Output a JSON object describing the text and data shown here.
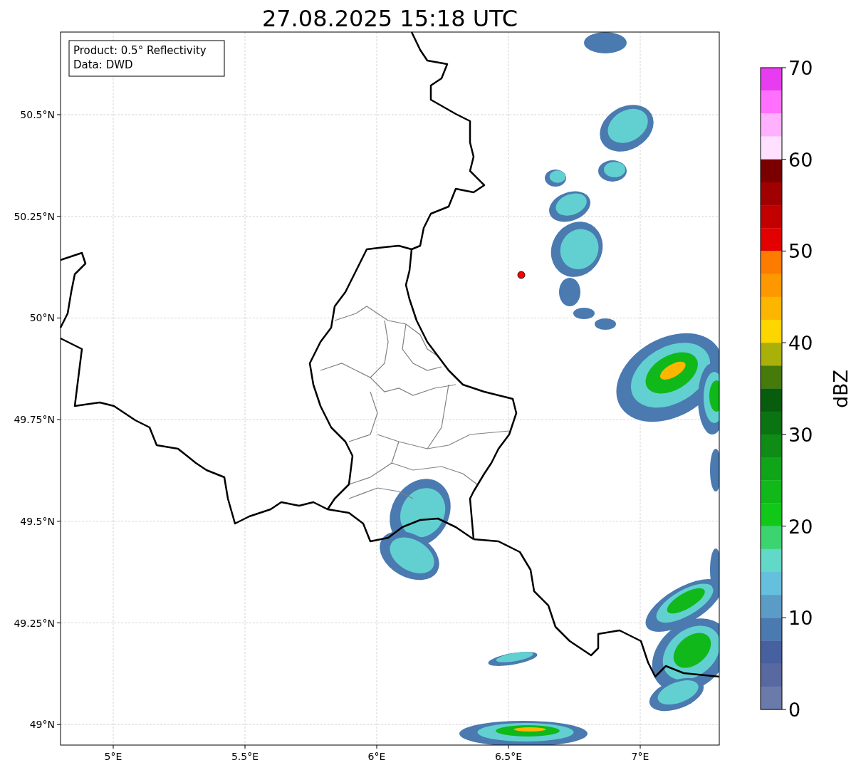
{
  "title": "27.08.2025 15:18 UTC",
  "info_box": {
    "lines": [
      "Product: 0.5° Reflectivity",
      "Data: DWD"
    ]
  },
  "map": {
    "x_ticks": [
      "5°E",
      "5.5°E",
      "6°E",
      "6.5°E",
      "7°E"
    ],
    "y_ticks": [
      "50.5°N",
      "50.25°N",
      "50°N",
      "49.75°N",
      "49.5°N",
      "49.25°N",
      "49°N"
    ]
  },
  "colorbar": {
    "label": "dBZ",
    "ticks": [
      "70",
      "60",
      "50",
      "40",
      "30",
      "20",
      "10",
      "0"
    ],
    "segments": [
      {
        "color": "#e83cf0"
      },
      {
        "color": "#ff70ff"
      },
      {
        "color": "#ffb0ff"
      },
      {
        "color": "#ffe0ff"
      },
      {
        "color": "#7a0000"
      },
      {
        "color": "#a00000"
      },
      {
        "color": "#c20000"
      },
      {
        "color": "#e20000"
      },
      {
        "color": "#fd7c00"
      },
      {
        "color": "#fd9800"
      },
      {
        "color": "#fdb600"
      },
      {
        "color": "#fdd600"
      },
      {
        "color": "#aab00a"
      },
      {
        "color": "#467a0a"
      },
      {
        "color": "#085c0e"
      },
      {
        "color": "#0a7412"
      },
      {
        "color": "#0e8c16"
      },
      {
        "color": "#10a418"
      },
      {
        "color": "#10b81a"
      },
      {
        "color": "#10c818"
      },
      {
        "color": "#3cd470"
      },
      {
        "color": "#62d8c8"
      },
      {
        "color": "#64c0dc"
      },
      {
        "color": "#5a9cc6"
      },
      {
        "color": "#4a7ab0"
      },
      {
        "color": "#4660a0"
      },
      {
        "color": "#5868a0"
      },
      {
        "color": "#6a7aaa"
      }
    ]
  }
}
